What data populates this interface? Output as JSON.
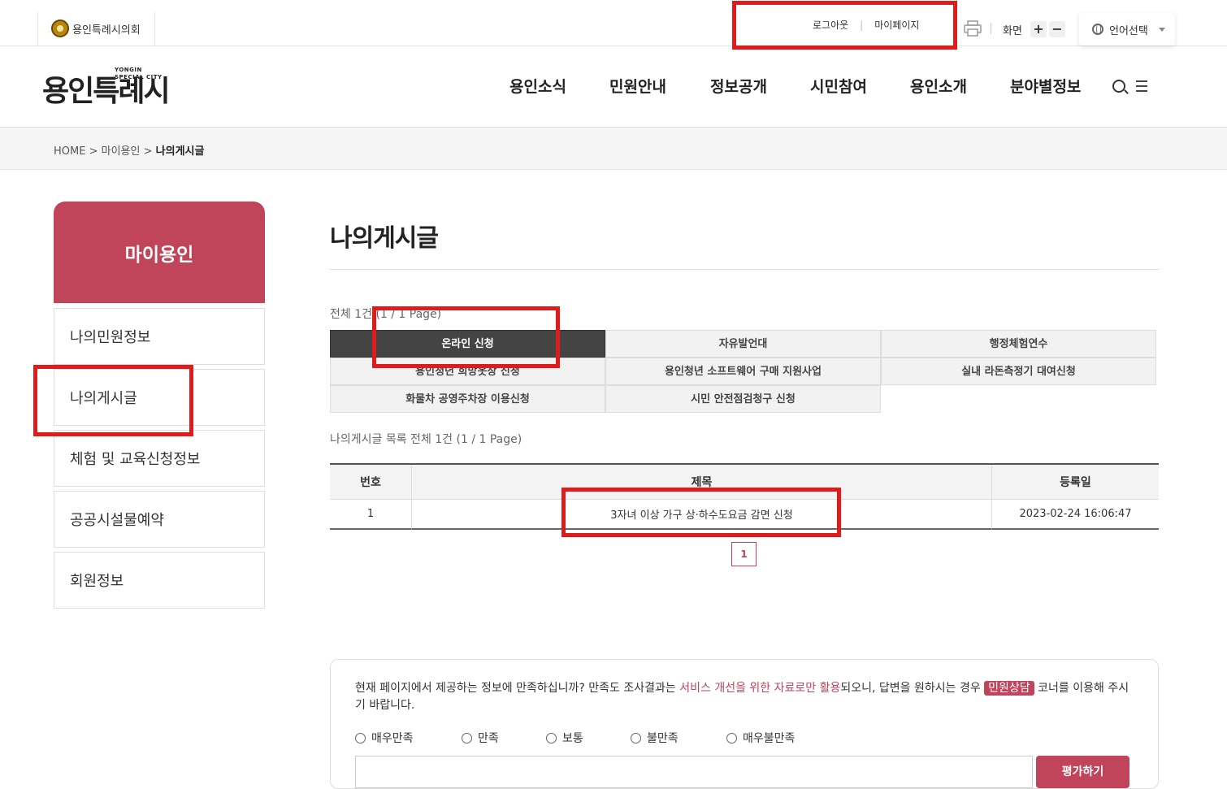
{
  "top": {
    "council": "용인특례시의회",
    "logout": "로그아웃",
    "mypage": "마이페이지",
    "screen": "화면",
    "zoom_in": "+",
    "zoom_out": "−",
    "language": "언어선택"
  },
  "logo": {
    "name": "용인특례시",
    "sub1": "YONGIN",
    "sub2": "SPECIAL CITY"
  },
  "gnb": [
    "용인소식",
    "민원안내",
    "정보공개",
    "시민참여",
    "용인소개",
    "분야별정보"
  ],
  "breadcrumb": {
    "home": "HOME",
    "sep": ">",
    "level1": "마이용인",
    "current": "나의게시글"
  },
  "lnb": {
    "title": "마이용인",
    "items": [
      "나의민원정보",
      "나의게시글",
      "체험 및 교육신청정보",
      "공공시설물예약",
      "회원정보"
    ]
  },
  "main": {
    "title": "나의게시글",
    "total_summary": "전체 1건 (1 / 1 Page)",
    "categories": [
      "온라인 신청",
      "자유발언대",
      "행정체험연수",
      "용인청년 희망옷장 신청",
      "용인청년 소프트웨어 구매 지원사업",
      "실내 라돈측정기 대여신청",
      "화물차 공영주차장 이용신청",
      "시민 안전점검청구 신청"
    ],
    "list_summary": "나의게시글 목록 전체 1건 (1 / 1 Page)",
    "table": {
      "headers": [
        "번호",
        "제목",
        "등록일"
      ],
      "rows": [
        {
          "no": "1",
          "title": "3자녀 이상 가구 상·하수도요금 감면 신청",
          "date": "2023-02-24 16:06:47"
        }
      ]
    },
    "page": "1"
  },
  "survey": {
    "text_a": "현재 페이지에서 제공하는 정보에 만족하십니까? 만족도 조사결과는 ",
    "text_hl": "서비스 개선을 위한 자료로만 활용",
    "text_b": "되오니, 답변을 원하시는 경우 ",
    "text_tag": "민원상담",
    "text_c": " 코너를 이용해 주시기 바랍니다.",
    "options": [
      "매우만족",
      "만족",
      "보통",
      "불만족",
      "매우불만족"
    ],
    "submit": "평가하기"
  },
  "colors": {
    "accent": "#c0445a",
    "highlight_box": "#e01b1b",
    "active_tab": "#444444"
  }
}
